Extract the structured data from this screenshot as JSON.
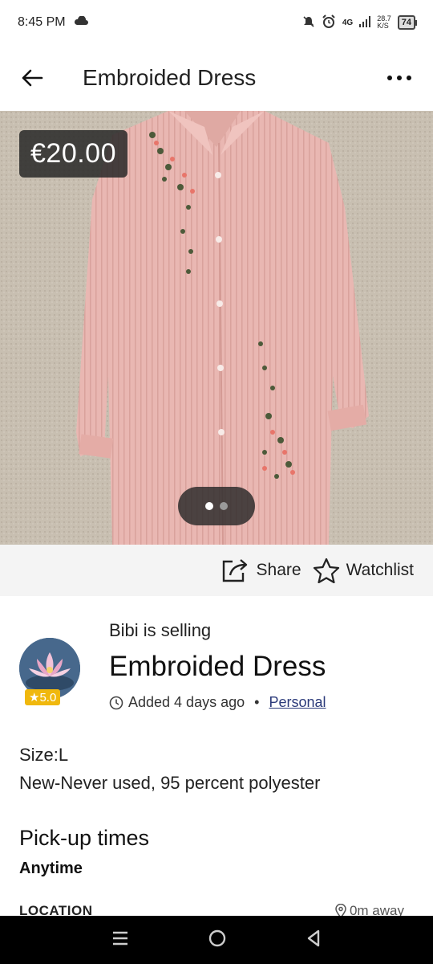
{
  "status_bar": {
    "time": "8:45 PM",
    "network": "4G",
    "speed_value": "28.7",
    "speed_unit": "K/S",
    "battery": "74"
  },
  "header": {
    "title": "Embroided Dress"
  },
  "listing": {
    "price": "€20.00",
    "photo_count": 2,
    "photo_index": 1
  },
  "actions": {
    "share_label": "Share",
    "watchlist_label": "Watchlist"
  },
  "seller": {
    "selling_text": "Bibi is selling",
    "rating": "★5.0",
    "item_title": "Embroided Dress",
    "added": "Added 4 days ago",
    "separator": "•",
    "type": "Personal"
  },
  "description": {
    "size": "Size:L",
    "details": "New-Never used, 95 percent polyester"
  },
  "pickup": {
    "title": "Pick-up times",
    "value": "Anytime"
  },
  "location": {
    "label": "LOCATION",
    "distance": "0m away"
  },
  "colors": {
    "dress": "#e8b4b0",
    "rating_badge": "#f0b80e",
    "link": "#2b3a7a"
  }
}
